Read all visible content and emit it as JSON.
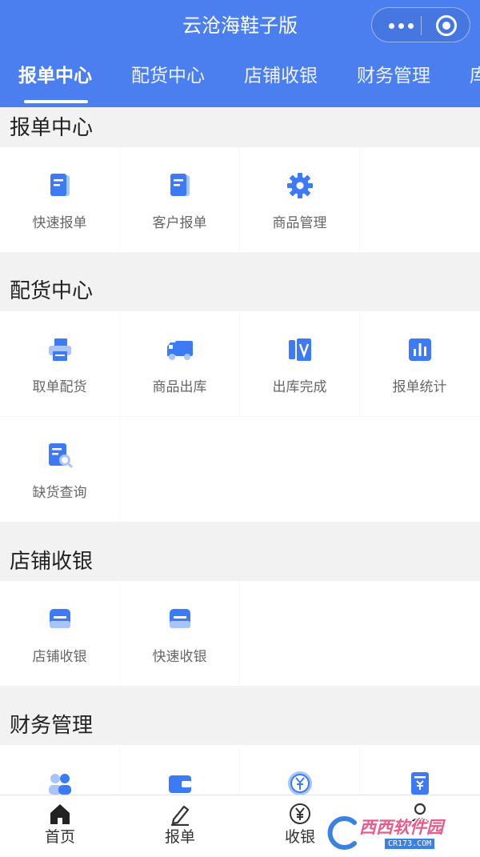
{
  "app": {
    "title": "云沧海鞋子版"
  },
  "tabs": [
    {
      "label": "报单中心"
    },
    {
      "label": "配货中心"
    },
    {
      "label": "店铺收银"
    },
    {
      "label": "财务管理"
    },
    {
      "label": "库"
    }
  ],
  "sections": [
    {
      "title": "报单中心",
      "items": [
        {
          "label": "快速报单",
          "icon": "document-icon"
        },
        {
          "label": "客户报单",
          "icon": "document-icon"
        },
        {
          "label": "商品管理",
          "icon": "gear-icon"
        }
      ]
    },
    {
      "title": "配货中心",
      "items": [
        {
          "label": "取单配货",
          "icon": "printer-icon"
        },
        {
          "label": "商品出库",
          "icon": "truck-icon"
        },
        {
          "label": "出库完成",
          "icon": "checklist-icon"
        },
        {
          "label": "报单统计",
          "icon": "bar-chart-icon"
        },
        {
          "label": "缺货查询",
          "icon": "search-document-icon"
        }
      ]
    },
    {
      "title": "店铺收银",
      "items": [
        {
          "label": "店铺收银",
          "icon": "cashier-icon"
        },
        {
          "label": "快速收银",
          "icon": "cashier-icon"
        }
      ]
    },
    {
      "title": "财务管理",
      "items": [
        {
          "label": "",
          "icon": "users-icon"
        },
        {
          "label": "",
          "icon": "wallet-icon"
        },
        {
          "label": "",
          "icon": "yen-coin-icon"
        },
        {
          "label": "",
          "icon": "receipt-icon"
        }
      ]
    }
  ],
  "tabbar": [
    {
      "label": "首页",
      "icon": "home-icon"
    },
    {
      "label": "报单",
      "icon": "pencil-icon"
    },
    {
      "label": "收银",
      "icon": "yen-icon"
    },
    {
      "label": "",
      "icon": "user-icon"
    }
  ],
  "watermark": {
    "text": "西西软件园",
    "subtext": "CR173.COM"
  },
  "colors": {
    "primary": "#4b7ff0",
    "icon_blue": "#3d7af5",
    "icon_light": "#a9c4f9"
  }
}
